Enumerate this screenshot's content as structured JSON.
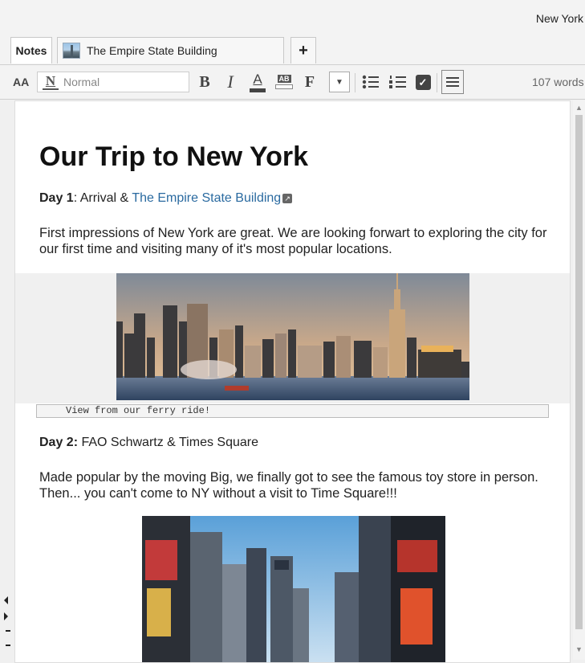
{
  "window": {
    "title": "New York"
  },
  "tabs": [
    {
      "label": "Notes"
    },
    {
      "label": "The Empire State Building",
      "icon": "building-thumbnail-icon"
    },
    {
      "label": "+"
    }
  ],
  "toolbar": {
    "font_size_label": "AA",
    "style_value": "Normal",
    "word_count": "107 words",
    "bold": "B",
    "italic": "I",
    "font_color": "A",
    "highlight": "AB",
    "font_family": "F"
  },
  "document": {
    "title": "Our Trip to New York",
    "day1": {
      "label": "Day 1",
      "text": ": Arrival & ",
      "link": "The Empire State Building"
    },
    "para1": "First impressions of New York are great. We are looking forwart to exploring the city for our first time and visiting many of it's most popular locations.",
    "image1_caption": "View from our ferry ride!",
    "day2": {
      "label": "Day 2:",
      "text": " FAO Schwartz & Times Square"
    },
    "para2": "Made popular by the moving Big, we finally got to see the famous toy store in person. Then... you can't come to NY without a visit to Time Square!!!"
  },
  "colors": {
    "link": "#2a6aa0",
    "page_bg": "#ffffff",
    "chrome_bg": "#f3f3f3"
  }
}
